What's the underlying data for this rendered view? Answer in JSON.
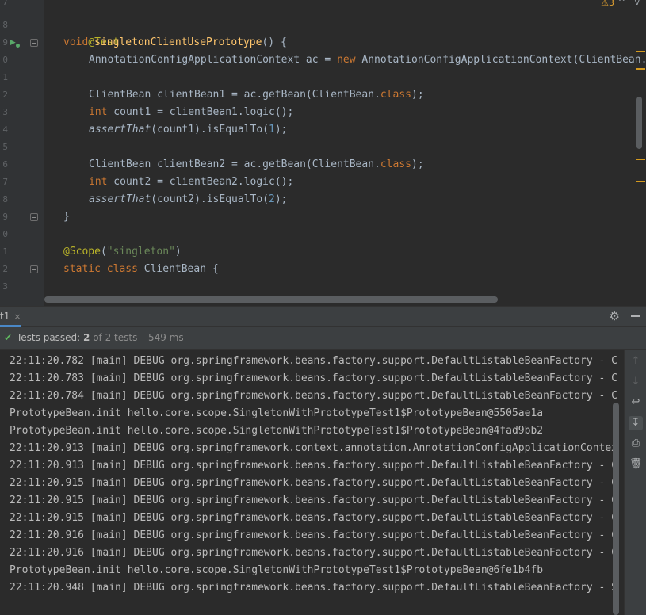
{
  "editor": {
    "line_numbers": [
      "7",
      "8",
      "9",
      "0",
      "1",
      "2",
      "3",
      "4",
      "5",
      "6",
      "7",
      "8",
      "9",
      "0",
      "1",
      "2",
      "3"
    ],
    "lines": {
      "l8_annotation": "@Test",
      "l9_void": "void ",
      "l9_method": "singletonClientUsePrototype",
      "l9_rest": "() {",
      "l10_a": "AnnotationConfigApplicationContext ac = ",
      "l10_new": "new",
      "l10_b": " AnnotationConfigApplicationContext(ClientBean.",
      "l12_a": "ClientBean clientBean1 = ac.getBean(ClientBean.",
      "l12_class": "class",
      "l12_b": ");",
      "l13_int": "int",
      "l13_b": " count1 = clientBean1.logic();",
      "l14_assert": "assertThat",
      "l14_a": "(count1).isEqualTo(",
      "l14_num": "1",
      "l14_b": ");",
      "l16_a": "ClientBean clientBean2 = ac.getBean(ClientBean.",
      "l16_class": "class",
      "l16_b": ");",
      "l17_int": "int",
      "l17_b": " count2 = clientBean2.logic();",
      "l18_assert": "assertThat",
      "l18_a": "(count2).isEqualTo(",
      "l18_num": "2",
      "l18_b": ");",
      "l19_brace": "}",
      "l21_annotation": "@Scope",
      "l21_paren1": "(",
      "l21_string": "\"singleton\"",
      "l21_paren2": ")",
      "l22_static": "static",
      "l22_class": "class",
      "l22_rest": " ClientBean {"
    },
    "warning_count": "3",
    "warning_icon": "warning-icon",
    "nav_up": "^",
    "nav_down": "v"
  },
  "run_panel": {
    "tab_label": "t1",
    "tab_close": "×",
    "status": {
      "prefix": "Tests passed: ",
      "passed": "2",
      "rest": " of 2 tests – 549 ms"
    },
    "log_lines": [
      "22:11:20.782 [main] DEBUG org.springframework.beans.factory.support.DefaultListableBeanFactory - C",
      "22:11:20.783 [main] DEBUG org.springframework.beans.factory.support.DefaultListableBeanFactory - C",
      "22:11:20.784 [main] DEBUG org.springframework.beans.factory.support.DefaultListableBeanFactory - C",
      "PrototypeBean.init hello.core.scope.SingletonWithPrototypeTest1$PrototypeBean@5505ae1a",
      "PrototypeBean.init hello.core.scope.SingletonWithPrototypeTest1$PrototypeBean@4fad9bb2",
      "22:11:20.913 [main] DEBUG org.springframework.context.annotation.AnnotationConfigApplicationContex",
      "22:11:20.913 [main] DEBUG org.springframework.beans.factory.support.DefaultListableBeanFactory - C",
      "22:11:20.915 [main] DEBUG org.springframework.beans.factory.support.DefaultListableBeanFactory - C",
      "22:11:20.915 [main] DEBUG org.springframework.beans.factory.support.DefaultListableBeanFactory - C",
      "22:11:20.915 [main] DEBUG org.springframework.beans.factory.support.DefaultListableBeanFactory - C",
      "22:11:20.916 [main] DEBUG org.springframework.beans.factory.support.DefaultListableBeanFactory - C",
      "22:11:20.916 [main] DEBUG org.springframework.beans.factory.support.DefaultListableBeanFactory - C",
      "PrototypeBean.init hello.core.scope.SingletonWithPrototypeTest1$PrototypeBean@6fe1b4fb",
      "22:11:20.948 [main] DEBUG org.springframework.beans.factory.support.DefaultListableBeanFactory - S"
    ]
  },
  "colors": {
    "editor_bg": "#2b2b2b",
    "keyword": "#cc7832",
    "annotation": "#bbb529",
    "method": "#ffc66d",
    "string": "#6a8759",
    "number": "#6897bb",
    "pass_green": "#5fb85f"
  }
}
